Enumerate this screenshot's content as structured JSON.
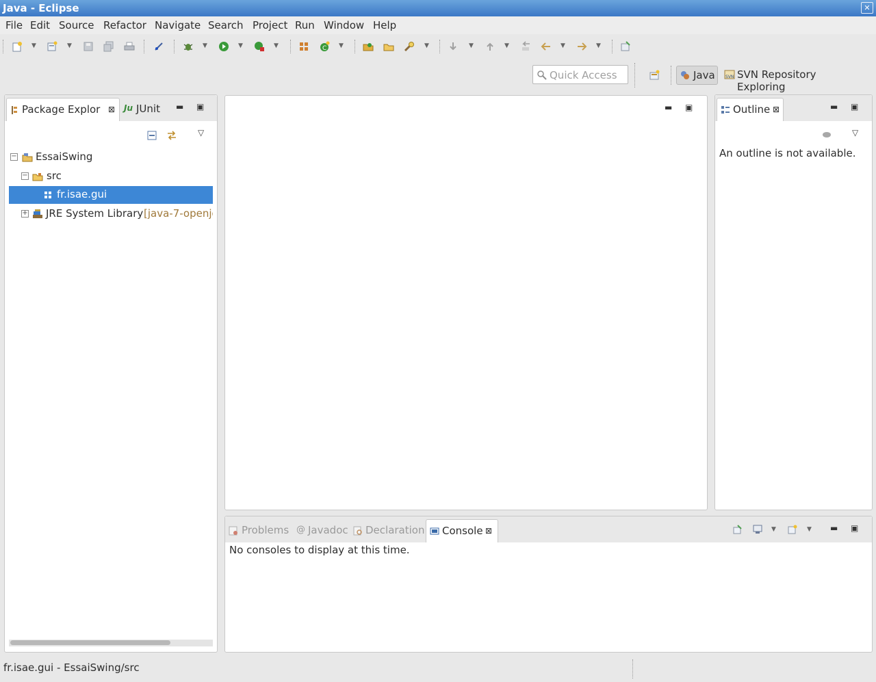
{
  "window": {
    "title": "Java - Eclipse"
  },
  "menu": [
    "File",
    "Edit",
    "Source",
    "Refactor",
    "Navigate",
    "Search",
    "Project",
    "Run",
    "Window",
    "Help"
  ],
  "quick_access": {
    "placeholder": "Quick Access"
  },
  "perspectives": {
    "java": "Java",
    "svn": "SVN Repository Exploring"
  },
  "left_panel": {
    "tabs": {
      "package_explorer": "Package Explor",
      "junit": "JUnit"
    },
    "tree": {
      "project": "EssaiSwing",
      "src": "src",
      "package": "fr.isae.gui",
      "jre": "JRE System Library",
      "jre_detail": "[java-7-openjd"
    }
  },
  "outline": {
    "tab": "Outline",
    "message": "An outline is not available."
  },
  "bottom_panel": {
    "tabs": {
      "problems": "Problems",
      "javadoc": "Javadoc",
      "declaration": "Declaration",
      "console": "Console"
    },
    "message": "No consoles to display at this time."
  },
  "status": {
    "text": "fr.isae.gui - EssaiSwing/src"
  },
  "colors": {
    "selection": "#3d87d6",
    "titlebar": "#3b78c6",
    "jre_detail": "#a0793a"
  }
}
